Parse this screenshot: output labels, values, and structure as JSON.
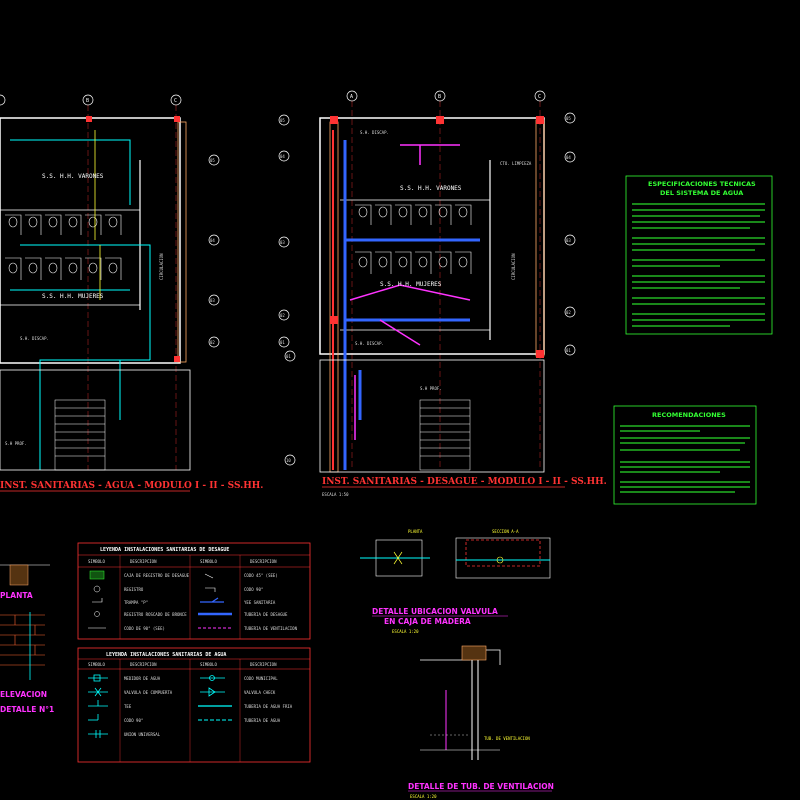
{
  "plans": {
    "agua": {
      "title": "INST. SANITARIAS - AGUA - MODULO I - II - SS.HH.",
      "room_varones": "S.S. H.H. VARONES",
      "room_mujeres": "S.S. H.H. MUJERES",
      "circulacion": "CIRCULACION",
      "grid_top": [
        "B",
        "C"
      ],
      "grid_right": [
        "05",
        "04",
        "03",
        "02"
      ],
      "sh_discap": "S.H. DISCAP.",
      "sh_prof": "S.H PROF."
    },
    "desague": {
      "title": "INST. SANITARIAS - DESAGUE - MODULO I - II - SS.HH.",
      "scale": "ESCALA 1:50",
      "room_varones": "S.S. H.H. VARONES",
      "room_mujeres": "S.S. H.H. MUJERES",
      "circulacion": "CIRCULACION",
      "grid_top": [
        "A",
        "B",
        "C"
      ],
      "grid_left": [
        "05",
        "04",
        "03",
        "02",
        "01",
        "01",
        "10"
      ],
      "grid_right": [
        "05",
        "04",
        "03",
        "02",
        "01"
      ],
      "sh_discap_top": "S.H. DISCAP.",
      "sh_discap_bottom": "S.H. DISCAP.",
      "sh_prof": "S.H PROF.",
      "cto_limpieza": "CTO. LIMPIEZA"
    }
  },
  "specs": {
    "title_line1": "ESPECIFICACIONES TECNICAS",
    "title_line2": "DEL SISTEMA DE AGUA"
  },
  "recomendaciones": {
    "title": "RECOMENDACIONES"
  },
  "legend_desague": {
    "title": "LEYENDA INSTALACIONES SANITARIAS DE DESAGUE",
    "headers": [
      "SIMBOLO",
      "DESCRIPCION",
      "SIMBOLO",
      "DESCRIPCION"
    ],
    "rows": [
      [
        "CAJA DE REGISTRO DE DESAGUE",
        "CODO 45° (SEE)"
      ],
      [
        "REGISTRO",
        "CODO 90°"
      ],
      [
        "TRAMPA \"P\"",
        "YEE SANITARIA"
      ],
      [
        "REGISTRO ROSCADO DE BRONCE",
        "TUBERIA DE DESAGUE"
      ],
      [
        "CODO DE 90° (SEE)",
        "TUBERIA DE VENTILACION"
      ]
    ]
  },
  "legend_agua": {
    "title": "LEYENDA INSTALACIONES SANITARIAS DE AGUA",
    "headers": [
      "SIMBOLO",
      "DESCRIPCION",
      "SIMBOLO",
      "DESCRIPCION"
    ],
    "rows": [
      [
        "MEDIDOR DE AGUA",
        "CODO MUNICIPAL"
      ],
      [
        "VALVULA DE COMPUERTA",
        "VALVULA CHECK"
      ],
      [
        "TEE",
        "TUBERIA DE AGUA FRIA"
      ],
      [
        "CODO 90°",
        "TUBERIA DE AGUA"
      ],
      [
        "UNION UNIVERSAL",
        ""
      ]
    ]
  },
  "details": {
    "valve_title_1": "DETALLE UBICACION VALVULA",
    "valve_title_2": "EN CAJA DE MADERA",
    "valve_sub": "ESCALA 1:20",
    "plan_label": "PLANTA",
    "section_label": "SECCION A-A",
    "vent_title": "DETALLE DE TUB. DE VENTILACION",
    "vent_scale": "ESCALA 1:20",
    "vent_label": "TUB. DE VENTILACION"
  },
  "left_fragments": {
    "planta": "PLANTA",
    "elevacion": "ELEVACION",
    "detalle": "DETALLE N°1"
  },
  "colors": {
    "background": "#000000",
    "wall": "#ffffff",
    "water_pipe": "#00ffff",
    "drain_pipe": "#3366ff",
    "vent_pipe": "#ff33ff",
    "column": "#ff3333",
    "title": "#ff3333",
    "spec_text": "#33ff33",
    "legend_border": "#ff3333"
  }
}
